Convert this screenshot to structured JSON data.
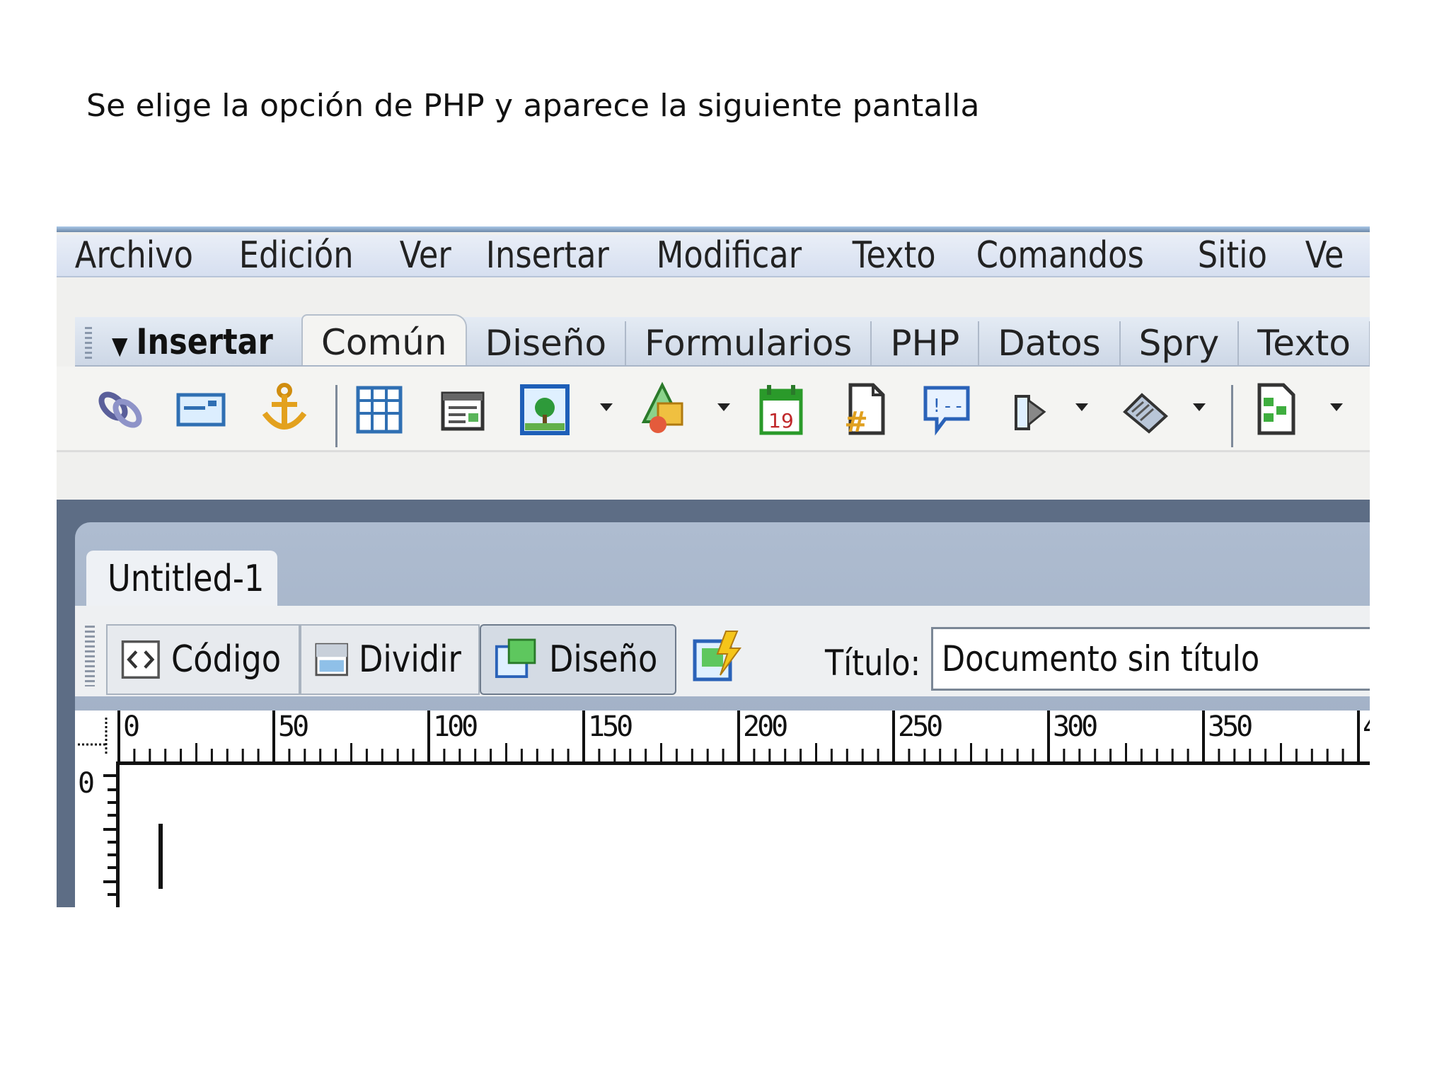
{
  "caption": "Se elige la opción de PHP y aparece la siguiente pantalla",
  "menu": [
    "Archivo",
    "Edición",
    "Ver",
    "Insertar",
    "Modificar",
    "Texto",
    "Comandos",
    "Sitio",
    "Ve"
  ],
  "insert_panel": {
    "title": "Insertar",
    "tabs": [
      "Común",
      "Diseño",
      "Formularios",
      "PHP",
      "Datos",
      "Spry",
      "Texto"
    ],
    "active_tab": "Común",
    "icons": [
      "hyperlink-icon",
      "email-link-icon",
      "named-anchor-icon",
      "table-icon",
      "insert-div-icon",
      "image-icon",
      "media-icon",
      "date-icon",
      "server-side-include-icon",
      "comment-icon",
      "head-icon",
      "script-icon",
      "templates-icon"
    ]
  },
  "document": {
    "tab_title": "Untitled-1",
    "view_buttons": {
      "code": "Código",
      "split": "Dividir",
      "design": "Diseño"
    },
    "active_view": "Diseño",
    "title_label": "Título:",
    "title_value": "Documento sin título",
    "ruler_labels": [
      "0",
      "50",
      "100",
      "150",
      "200",
      "250",
      "300",
      "350",
      "4"
    ],
    "vruler_label": "0"
  },
  "colors": {
    "menubar": "#dbe3f1",
    "frame": "#5d6d85",
    "doc_area": "#ffffff"
  }
}
